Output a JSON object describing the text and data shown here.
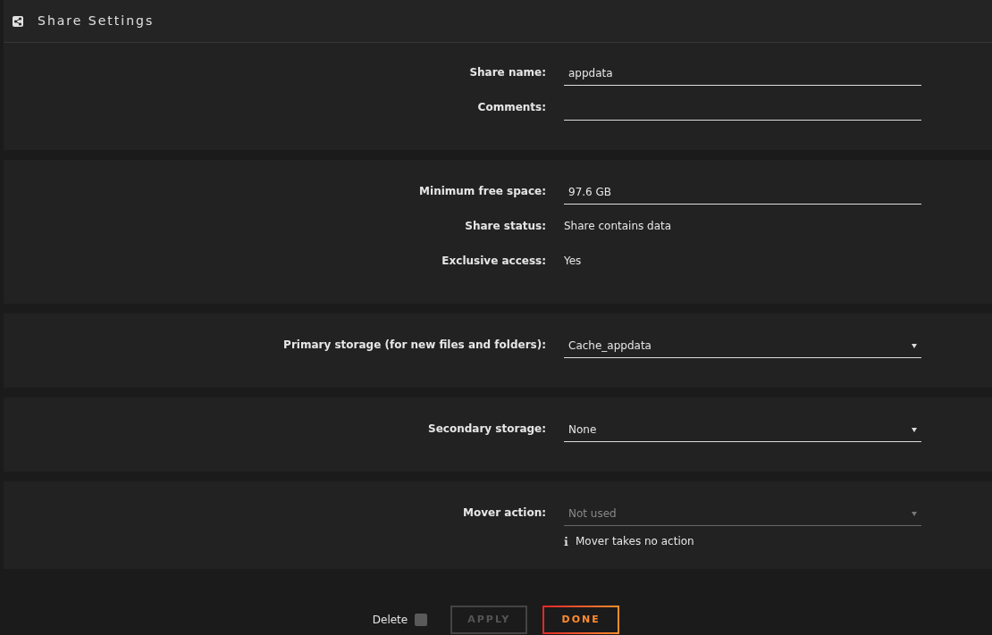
{
  "header": {
    "title": "Share Settings"
  },
  "sections": [
    {
      "rows": [
        {
          "kind": "input",
          "label": "Share name:",
          "value": "appdata"
        },
        {
          "kind": "input",
          "label": "Comments:"
        }
      ]
    },
    {
      "rows": [
        {
          "kind": "input",
          "label": "Minimum free space:",
          "value": "97.6 GB"
        },
        {
          "kind": "text",
          "label": "Share status:",
          "value": "Share contains data"
        },
        {
          "kind": "text",
          "label": "Exclusive access:",
          "value": "Yes"
        }
      ]
    },
    {
      "rows": [
        {
          "kind": "select",
          "label": "Primary storage (for new files and folders):",
          "value": "Cache_appdata",
          "disabled": false
        }
      ]
    },
    {
      "rows": [
        {
          "kind": "select",
          "label": "Secondary storage:",
          "value": "None",
          "disabled": false
        }
      ]
    },
    {
      "rows": [
        {
          "kind": "select",
          "label": "Mover action:",
          "value": "Not used",
          "disabled": true,
          "note": "Mover takes no action"
        }
      ]
    }
  ],
  "footer": {
    "delete_label": "Delete",
    "delete_checked": false,
    "buttons": [
      {
        "label": "APPLY",
        "disabled": true
      },
      {
        "label": "DONE",
        "disabled": false
      }
    ]
  }
}
